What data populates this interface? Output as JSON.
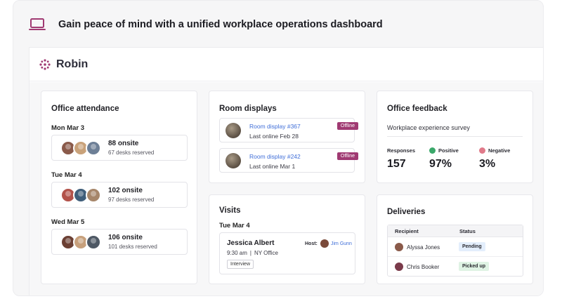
{
  "headline": {
    "text": "Gain peace of mind with a unified workplace operations dashboard",
    "icon": "laptop-icon"
  },
  "brand": {
    "logo_text": "Robin",
    "accent": "#a03a72"
  },
  "attendance": {
    "title": "Office attendance",
    "days": [
      {
        "label": "Mon Mar 3",
        "onsite": "88 onsite",
        "reserved": "67 desks reserved",
        "avatar_colors": [
          "#8a5a4a",
          "#c9a27a",
          "#6d7f96"
        ]
      },
      {
        "label": "Tue Mar 4",
        "onsite": "102 onsite",
        "reserved": "97 desks reserved",
        "avatar_colors": [
          "#b2524a",
          "#3f5e7a",
          "#a6866a"
        ]
      },
      {
        "label": "Wed Mar 5",
        "onsite": "106 onsite",
        "reserved": "101 desks reserved",
        "avatar_colors": [
          "#6b3f33",
          "#c7a07c",
          "#4e5864"
        ]
      }
    ]
  },
  "room_displays": {
    "title": "Room displays",
    "items": [
      {
        "name": "Room display #367",
        "last_online": "Last online Feb 28",
        "status": "Offline"
      },
      {
        "name": "Room display #242",
        "last_online": "Last online Mar 1",
        "status": "Offline"
      }
    ]
  },
  "feedback": {
    "title": "Office feedback",
    "survey": "Workplace experience survey",
    "stats": [
      {
        "label": "Responses",
        "value": "157",
        "dot_color": ""
      },
      {
        "label": "Positive",
        "value": "97%",
        "dot_color": "#3aa86a"
      },
      {
        "label": "Negative",
        "value": "3%",
        "dot_color": "#e07a8a"
      }
    ]
  },
  "visits": {
    "title": "Visits",
    "day": "Tue Mar 4",
    "visitor": "Jessica Albert",
    "host_label": "Host:",
    "host_name": "Jim Gunn",
    "time": "9:30 am",
    "separator": "|",
    "location": "NY Office",
    "tag": "Interview"
  },
  "deliveries": {
    "title": "Deliveries",
    "headers": [
      "Recipient",
      "Status"
    ],
    "rows": [
      {
        "recipient": "Alyssa Jones",
        "status": "Pending",
        "status_bg": "#e3eefc",
        "avatar_color": "#8a5a4a"
      },
      {
        "recipient": "Chris Booker",
        "status": "Picked up",
        "status_bg": "#dff3e4",
        "avatar_color": "#7a3a4a"
      }
    ]
  }
}
